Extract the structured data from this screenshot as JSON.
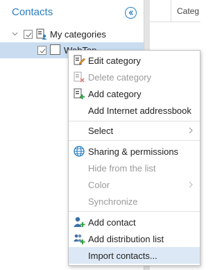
{
  "panel": {
    "title": "Contacts",
    "tree": {
      "root_label": "My categories",
      "child_label": "WebTop"
    }
  },
  "grid": {
    "column_header": "Categ"
  },
  "context_menu": {
    "items": [
      {
        "label": "Edit category",
        "icon": "edit-category-icon",
        "enabled": true
      },
      {
        "label": "Delete category",
        "icon": "delete-category-icon",
        "enabled": false
      },
      {
        "label": "Add category",
        "icon": "add-category-icon",
        "enabled": true
      },
      {
        "label": "Add Internet addressbook",
        "icon": "",
        "enabled": true
      },
      {
        "label": "Select",
        "icon": "",
        "enabled": true,
        "submenu": true
      },
      {
        "label": "Sharing & permissions",
        "icon": "globe-icon",
        "enabled": true
      },
      {
        "label": "Hide from the list",
        "icon": "",
        "enabled": false
      },
      {
        "label": "Color",
        "icon": "",
        "enabled": false,
        "submenu": true
      },
      {
        "label": "Synchronize",
        "icon": "",
        "enabled": false
      },
      {
        "label": "Add contact",
        "icon": "add-contact-icon",
        "enabled": true
      },
      {
        "label": "Add distribution list",
        "icon": "add-distribution-list-icon",
        "enabled": true
      },
      {
        "label": "Import contacts...",
        "icon": "",
        "enabled": true,
        "hovered": true
      }
    ]
  },
  "colors": {
    "accent": "#2b7fc4",
    "selection": "#c9dcf0",
    "menu_hover": "#dce8f5"
  }
}
